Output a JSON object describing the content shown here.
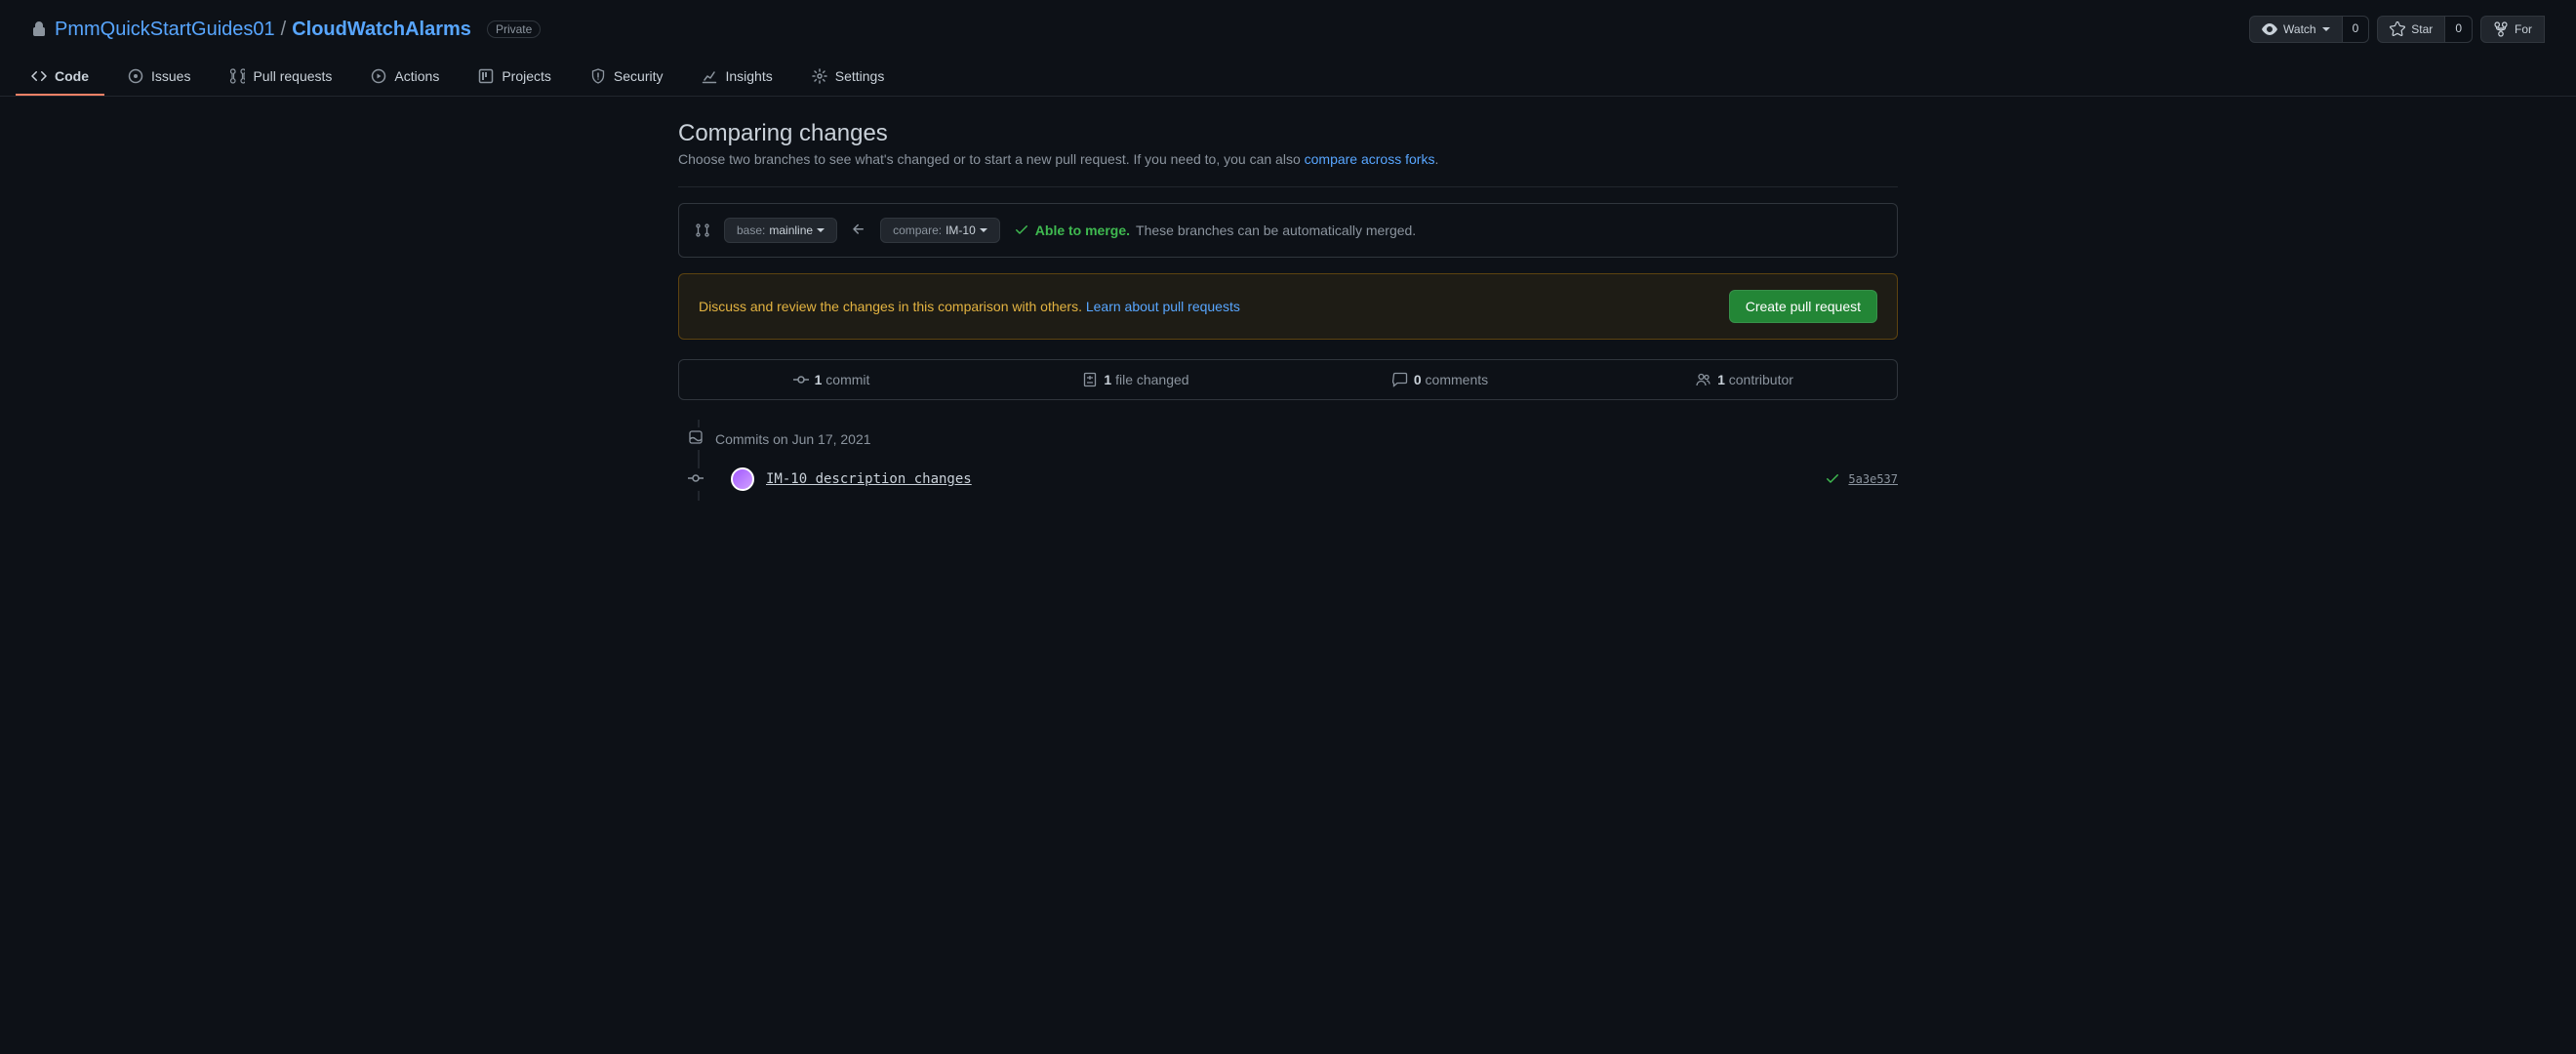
{
  "repo": {
    "owner": "PmmQuickStartGuides01",
    "name": "CloudWatchAlarms",
    "visibility": "Private"
  },
  "actions": {
    "watch": {
      "label": "Watch",
      "count": "0"
    },
    "star": {
      "label": "Star",
      "count": "0"
    },
    "fork": {
      "label": "For"
    }
  },
  "tabs": {
    "code": "Code",
    "issues": "Issues",
    "pulls": "Pull requests",
    "actions": "Actions",
    "projects": "Projects",
    "security": "Security",
    "insights": "Insights",
    "settings": "Settings"
  },
  "page": {
    "title": "Comparing changes",
    "subtitle_pre": "Choose two branches to see what's changed or to start a new pull request. If you need to, you can also ",
    "subtitle_link": "compare across forks",
    "subtitle_post": "."
  },
  "range": {
    "base_label": "base: ",
    "base_value": "mainline",
    "compare_label": "compare: ",
    "compare_value": "IM-10",
    "able": "Able to merge.",
    "detail": "These branches can be automatically merged."
  },
  "cta": {
    "text": "Discuss and review the changes in this comparison with others. ",
    "link": "Learn about pull requests",
    "button": "Create pull request"
  },
  "stats": {
    "commits_n": "1",
    "commits_l": " commit",
    "files_n": "1",
    "files_l": " file changed",
    "comments_n": "0",
    "comments_l": " comments",
    "contrib_n": "1",
    "contrib_l": " contributor"
  },
  "commits": {
    "date_header": "Commits on Jun 17, 2021",
    "items": [
      {
        "message": "IM-10 description changes",
        "sha": "5a3e537"
      }
    ]
  }
}
